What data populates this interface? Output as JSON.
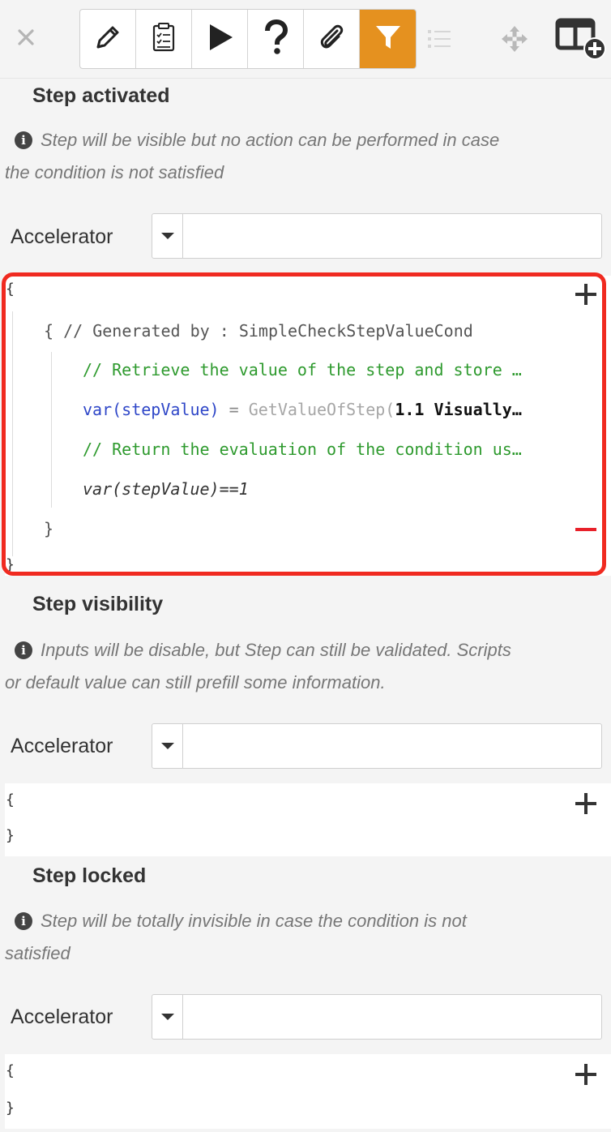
{
  "toolbar": {
    "close_icon": "close-icon",
    "buttons": [
      {
        "icon": "pencil-icon"
      },
      {
        "icon": "checklist-icon"
      },
      {
        "icon": "play-icon"
      },
      {
        "icon": "help-icon"
      },
      {
        "icon": "paperclip-icon"
      },
      {
        "icon": "filter-icon",
        "active": true
      }
    ],
    "extras": [
      "list-icon",
      "move-icon",
      "add-column-icon"
    ],
    "accent_color": "#e5911f"
  },
  "sections": [
    {
      "title": "Step activated",
      "info_line1": "Step will be visible but no action can be performed in case",
      "info_line2": "the condition is not satisfied",
      "accelerator_label": "Accelerator",
      "accelerator_value": "",
      "code": {
        "open_brace": "{",
        "close_brace": "}",
        "block_open": "{ // Generated by : SimpleCheckStepValueCond",
        "comment1": "// Retrieve the value of the step and store …",
        "var_part": "var(stepValue)",
        "eq_part": " = ",
        "func_part": "GetValueOfStep(",
        "arg_part": "1.1 Visually…",
        "comment2": "// Return the evaluation of the condition us…",
        "expr": "var(stepValue)==1",
        "block_close": "}"
      }
    },
    {
      "title": "Step visibility",
      "info_line1": "Inputs will be disable, but Step can still be validated. Scripts",
      "info_line2": "or default value can still prefill some information.",
      "accelerator_label": "Accelerator",
      "accelerator_value": "",
      "code": {
        "open_brace": "{",
        "close_brace": "}"
      }
    },
    {
      "title": "Step locked",
      "info_line1": "Step will be totally invisible in case the condition is not",
      "info_line2": "satisfied",
      "accelerator_label": "Accelerator",
      "accelerator_value": "",
      "code": {
        "open_brace": "{",
        "close_brace": "}"
      }
    }
  ],
  "info_glyph": "i",
  "colors": {
    "comment": "#2e9a2e",
    "keyword": "#2f47c8",
    "highlight_frame": "#f02a20",
    "minus": "#e8212a"
  }
}
